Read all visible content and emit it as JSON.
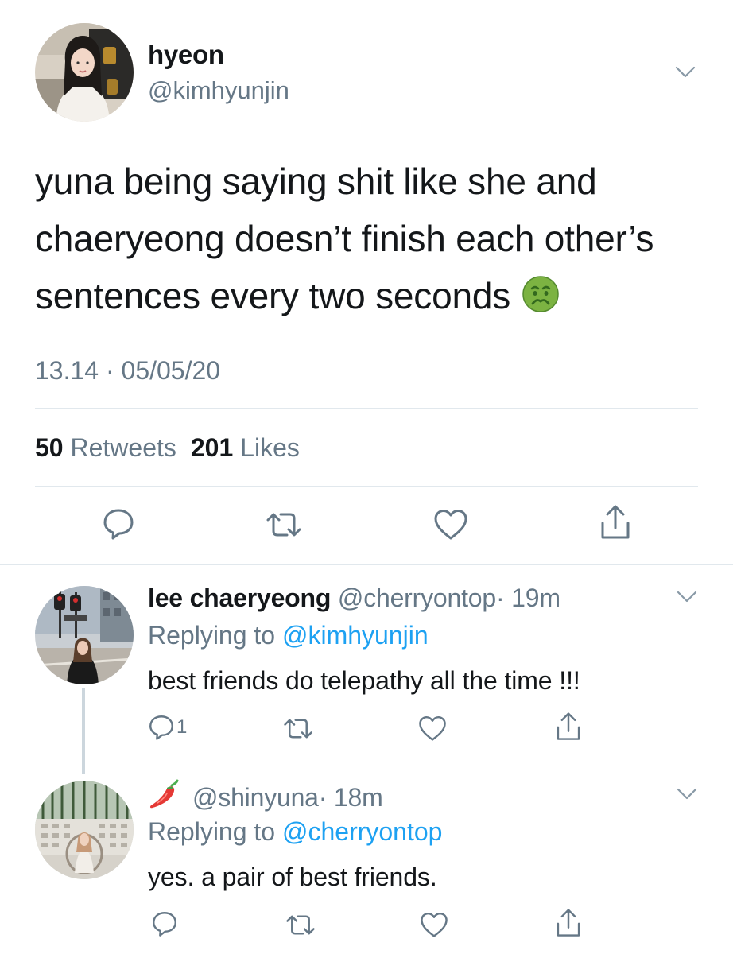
{
  "main_tweet": {
    "display_name": "hyeon",
    "handle": "@kimhyunjin",
    "text": "yuna being saying shit like she and chaeryeong doesn’t finish each other’s sentences every two seconds",
    "emoji_icon": "nauseated-face",
    "timestamp": "13.14 · 05/05/20",
    "retweets_count": "50",
    "retweets_label": "Retweets",
    "likes_count": "201",
    "likes_label": "Likes"
  },
  "replies": [
    {
      "display_name": "lee chaeryeong",
      "handle": "@cherryontop",
      "time": "· 19m",
      "replying_to_label": "Replying to",
      "replying_to_handle": "@kimhyunjin",
      "text": "best friends do telepathy all the time !!!",
      "reply_count": "1"
    },
    {
      "display_name_icon": "chili-pepper",
      "handle": "@shinyuna",
      "time": "· 18m",
      "replying_to_label": "Replying to",
      "replying_to_handle": "@cherryontop",
      "text": "yes. a pair of best friends."
    }
  ],
  "colors": {
    "text": "#14171a",
    "secondary": "#657786",
    "link": "#1da1f2",
    "divider": "#e1e8ed",
    "thread_line": "#ccd6dd"
  }
}
